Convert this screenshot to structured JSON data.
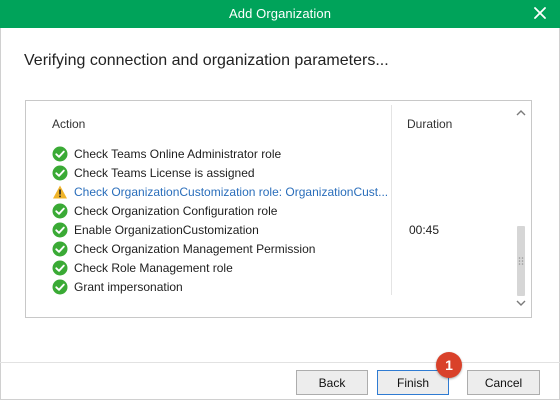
{
  "window": {
    "title": "Add Organization",
    "accent_color": "#00a35a",
    "close_icon": "close-icon"
  },
  "heading": "Verifying connection and organization parameters...",
  "table": {
    "columns": {
      "action": "Action",
      "duration": "Duration"
    },
    "rows": [
      {
        "status": "success",
        "action": "Check Teams Online Administrator role",
        "duration": ""
      },
      {
        "status": "success",
        "action": "Check Teams License is assigned",
        "duration": ""
      },
      {
        "status": "warning",
        "action": "Check OrganizationCustomization role: OrganizationCust...",
        "duration": ""
      },
      {
        "status": "success",
        "action": "Check Organization Configuration role",
        "duration": ""
      },
      {
        "status": "success",
        "action": "Enable OrganizationCustomization",
        "duration": "00:45"
      },
      {
        "status": "success",
        "action": "Check Organization Management Permission",
        "duration": ""
      },
      {
        "status": "success",
        "action": "Check Role Management role",
        "duration": ""
      },
      {
        "status": "success",
        "action": "Grant impersonation",
        "duration": ""
      }
    ]
  },
  "buttons": {
    "back": "Back",
    "finish": "Finish",
    "cancel": "Cancel"
  },
  "annotation_badge": "1",
  "colors": {
    "success": "#3aaa35",
    "warning": "#f0b429",
    "warning_text": "#2a6ebb",
    "badge": "#d9412a"
  }
}
